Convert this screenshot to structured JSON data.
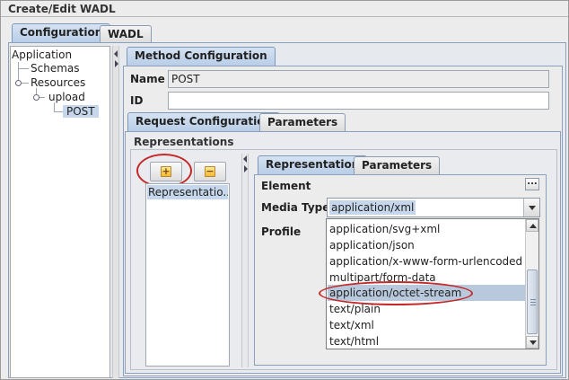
{
  "window": {
    "title": "Create/Edit WADL"
  },
  "outer_tabs": [
    {
      "label": "Configuration",
      "active": true
    },
    {
      "label": "WADL",
      "active": false
    }
  ],
  "tree": {
    "items": [
      "Application",
      "Schemas",
      "Resources",
      "upload",
      "POST"
    ],
    "selected": "POST"
  },
  "method_tab": {
    "label": "Method Configuration"
  },
  "method": {
    "name_label": "Name",
    "name_value": "POST",
    "id_label": "ID",
    "id_value": ""
  },
  "request_tabs": [
    {
      "label": "Request Configuration",
      "active": true
    },
    {
      "label": "Parameters",
      "active": false
    }
  ],
  "representations": {
    "group_title": "Representations",
    "add_icon": "plus-icon",
    "remove_icon": "minus-icon",
    "list_items": [
      "Representatio..."
    ]
  },
  "rep_tabs": [
    {
      "label": "Representation",
      "active": true
    },
    {
      "label": "Parameters",
      "active": false
    }
  ],
  "rep_form": {
    "element_label": "Element",
    "element_button": "...",
    "media_type_label": "Media Type",
    "media_type_value": "application/xml",
    "profile_label": "Profile"
  },
  "dropdown": {
    "options": [
      "application/svg+xml",
      "application/json",
      "application/x-www-form-urlencoded",
      "multipart/form-data",
      "application/octet-stream",
      "text/plain",
      "text/xml",
      "text/html"
    ],
    "highlighted": "application/octet-stream"
  },
  "colors": {
    "annotation_oval": "#c42a2a",
    "selection": "#c6d7ec",
    "active_tab": "#b7cce6"
  }
}
